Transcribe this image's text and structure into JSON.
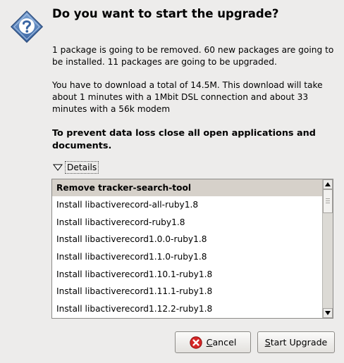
{
  "dialog": {
    "title": "Do you want to start the upgrade?",
    "icon": "question-icon",
    "summary": "1 package is going to be removed. 60 new packages are going to be installed. 11 packages are going to be upgraded.",
    "download": "You have to download a total of 14.5M. This download will take about 1 minutes with a 1Mbit DSL connection and about 33 minutes with a 56k modem",
    "warning": "To prevent data loss close all open applications and documents."
  },
  "details": {
    "label": "Details",
    "expanded": true,
    "items": [
      "Remove tracker-search-tool",
      "Install libactiverecord-all-ruby1.8",
      "Install libactiverecord-ruby1.8",
      "Install libactiverecord1.0.0-ruby1.8",
      "Install libactiverecord1.1.0-ruby1.8",
      "Install libactiverecord1.10.1-ruby1.8",
      "Install libactiverecord1.11.1-ruby1.8",
      "Install libactiverecord1.12.2-ruby1.8"
    ],
    "selected_index": 0,
    "scroll_position": 0
  },
  "buttons": {
    "cancel": {
      "mnemonic": "C",
      "rest": "ancel",
      "icon": "cancel-icon"
    },
    "start": {
      "mnemonic": "S",
      "rest": "tart Upgrade"
    }
  },
  "colors": {
    "background": "#edeceb",
    "selected_row": "#d6d1ca",
    "icon_blue": "#3f6dac",
    "cancel_red": "#d62626"
  }
}
